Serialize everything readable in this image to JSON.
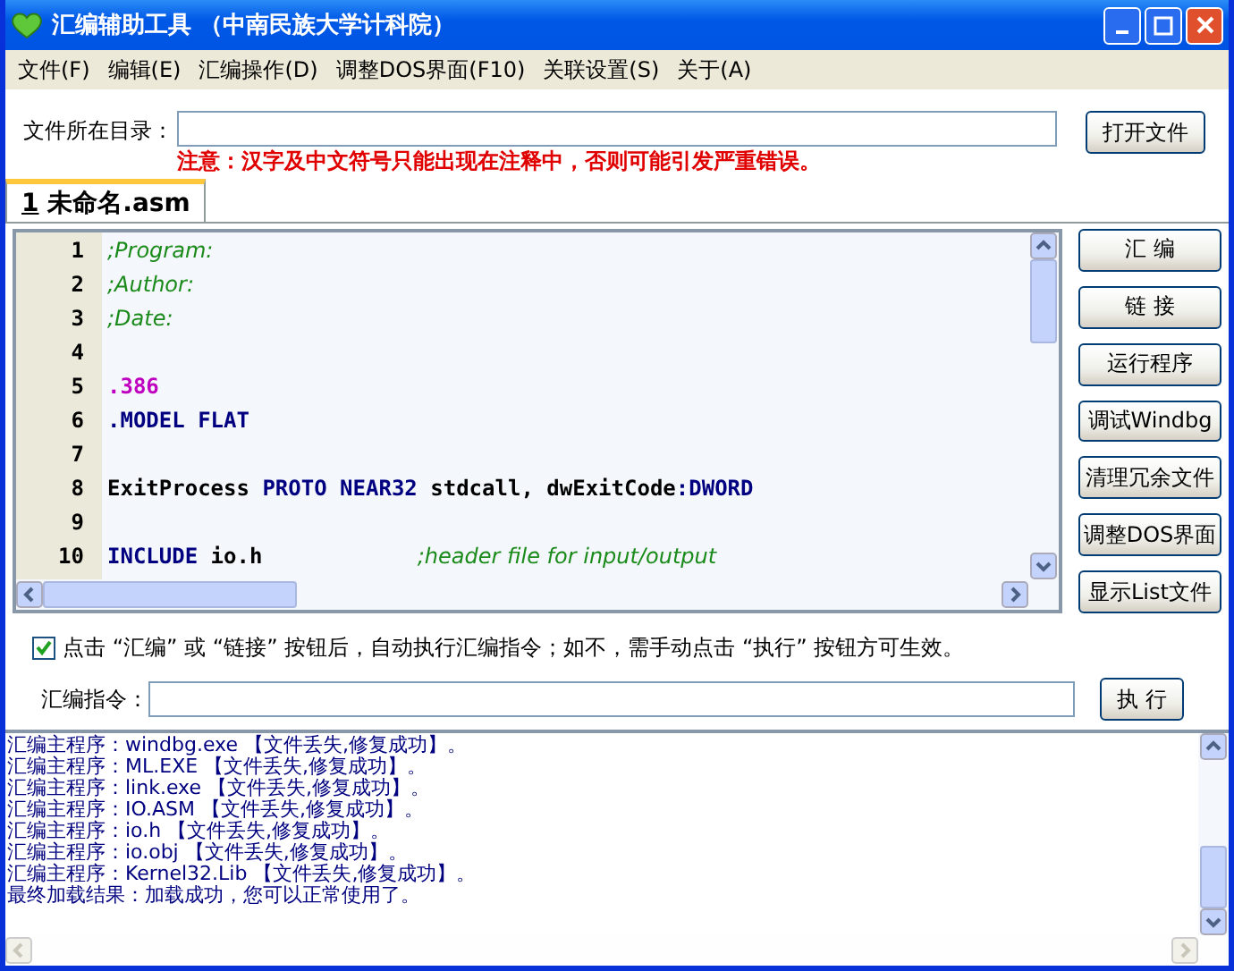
{
  "window": {
    "title": "汇编辅助工具 （中南民族大学计科院）"
  },
  "menu": [
    "文件(F)",
    "编辑(E)",
    "汇编操作(D)",
    "调整DOS界面(F10)",
    "关联设置(S)",
    "关于(A)"
  ],
  "directory": {
    "label": "文件所在目录：",
    "warning": "注意：汉字及中文符号只能出现在注释中，否则可能引发严重错误。",
    "button": "打开文件"
  },
  "tabs": [
    {
      "index": "1",
      "label": "未命名.asm",
      "selected": true
    }
  ],
  "editor": {
    "lines": [
      {
        "number": "1",
        "tokens": [
          {
            "kind": "comment",
            "text": ";Program:"
          }
        ]
      },
      {
        "number": "2",
        "tokens": [
          {
            "kind": "comment",
            "text": ";Author:"
          }
        ]
      },
      {
        "number": "3",
        "tokens": [
          {
            "kind": "comment",
            "text": ";Date:"
          }
        ]
      },
      {
        "number": "4"
      },
      {
        "number": "5",
        "tokens": [
          {
            "kind": "directive",
            "text": ".386"
          }
        ]
      },
      {
        "number": "6",
        "tokens": [
          {
            "kind": "keyword",
            "text": ".MODEL FLAT"
          }
        ]
      },
      {
        "number": "7"
      },
      {
        "number": "8",
        "tokens": [
          {
            "kind": "plain",
            "text": "ExitProcess "
          },
          {
            "kind": "keyword",
            "text": "PROTO NEAR32 "
          },
          {
            "kind": "plain",
            "text": "stdcall, dwExitCode"
          },
          {
            "kind": "keyword",
            "text": ":DWORD"
          }
        ]
      },
      {
        "number": "9"
      },
      {
        "number": "10",
        "tokens": [
          {
            "kind": "keyword",
            "text": "INCLUDE "
          },
          {
            "kind": "plain",
            "text": "io.h            "
          },
          {
            "kind": "comment",
            "text": ";header file for input/output"
          }
        ]
      }
    ]
  },
  "side_buttons": [
    "汇 编",
    "链 接",
    "运行程序",
    "调试Windbg",
    "清理冗余文件",
    "调整DOS界面",
    "显示List文件"
  ],
  "auto_execute": {
    "checked": true,
    "label": "点击 “汇编” 或 “链接” 按钮后，自动执行汇编指令；如不，需手动点击 “执行” 按钮方可生效。"
  },
  "command": {
    "label": "汇编指令：",
    "button": "执 行"
  },
  "output": [
    "汇编主程序：windbg.exe  【文件丢失,修复成功】。",
    "汇编主程序：ML.EXE  【文件丢失,修复成功】。",
    "汇编主程序：link.exe  【文件丢失,修复成功】。",
    "汇编主程序：IO.ASM  【文件丢失,修复成功】。",
    "汇编主程序：io.h  【文件丢失,修复成功】。",
    "汇编主程序：io.obj  【文件丢失,修复成功】。",
    "汇编主程序：Kernel32.Lib  【文件丢失,修复成功】。",
    "最终加载结果：加载成功，您可以正常使用了。"
  ]
}
